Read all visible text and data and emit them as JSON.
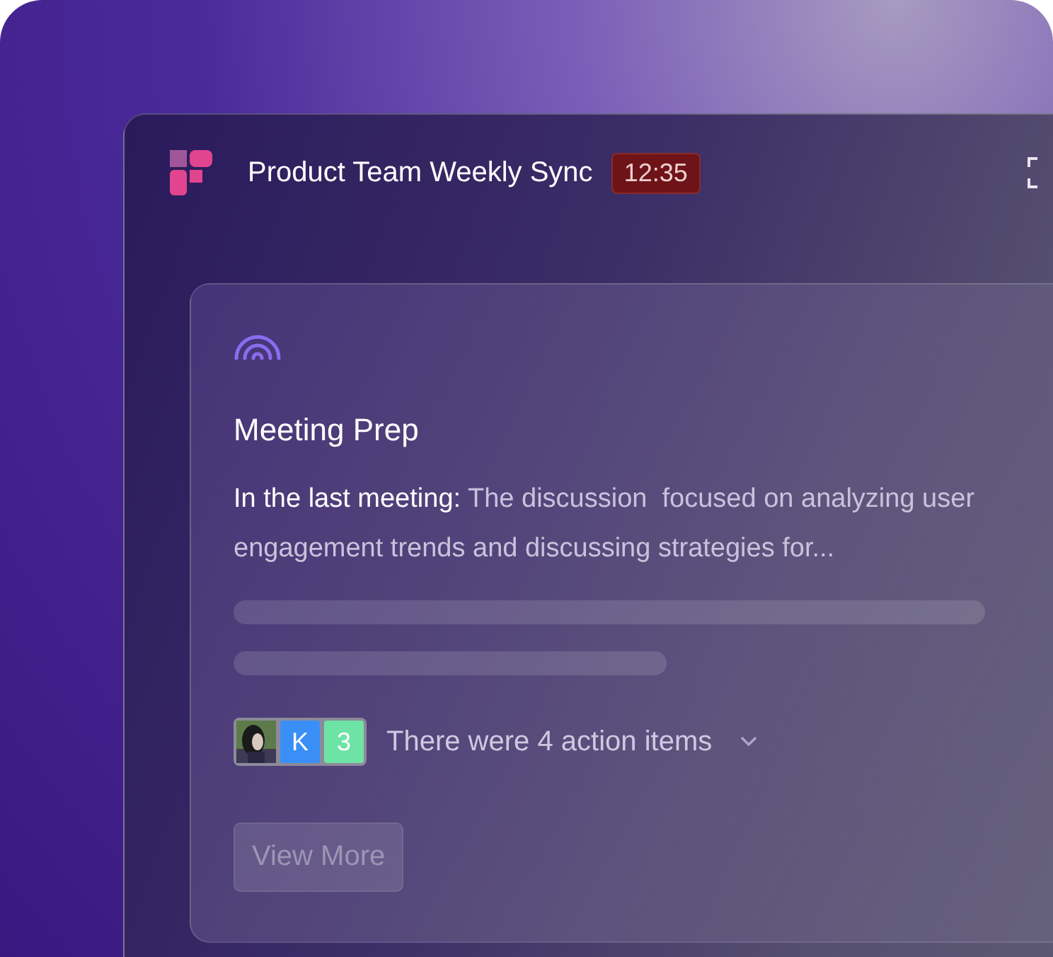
{
  "window": {
    "title": "Product Team Weekly Sync",
    "timer": "12:35"
  },
  "card": {
    "title": "Meeting Prep",
    "summary": "**In the last meeting:** The discussion  focused on analyzing user engagement trends and discussing strategies for...",
    "avatars": [
      {
        "kind": "picture"
      },
      {
        "kind": "initial",
        "label": "K",
        "color": "#3a8ff6"
      },
      {
        "kind": "initial",
        "label": "3",
        "color": "#6ee3a6"
      }
    ],
    "action_items": "There were 4 action items",
    "button": "View More"
  }
}
